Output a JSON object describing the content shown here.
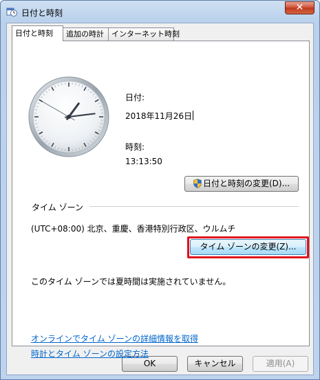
{
  "window": {
    "title": "日付と時刻",
    "close_label": "✕"
  },
  "tabs": [
    {
      "label": "日付と時刻",
      "active": true
    },
    {
      "label": "追加の時計",
      "active": false
    },
    {
      "label": "インターネット時刻",
      "active": false
    }
  ],
  "clock": {
    "time": "13:13:50"
  },
  "date_section": {
    "date_label": "日付:",
    "date_value": "2018年11月26日",
    "time_label": "時刻:",
    "time_value": "13:13:50",
    "change_button": "日付と時刻の変更(D)..."
  },
  "timezone_section": {
    "heading": "タイム ゾーン",
    "zone_value": "(UTC+08:00) 北京、重慶、香港特別行政区、ウルムチ",
    "change_button": "タイム ゾーンの変更(Z)...",
    "dst_note": "このタイム ゾーンでは夏時間は実施されていません。"
  },
  "links": [
    "オンラインでタイム ゾーンの詳細情報を取得",
    "時計とタイム ゾーンの設定方法"
  ],
  "footer": {
    "ok": "OK",
    "cancel": "キャンセル",
    "apply": "適用(A)"
  },
  "colors": {
    "highlight": "#e0101a",
    "link": "#0066cc"
  }
}
